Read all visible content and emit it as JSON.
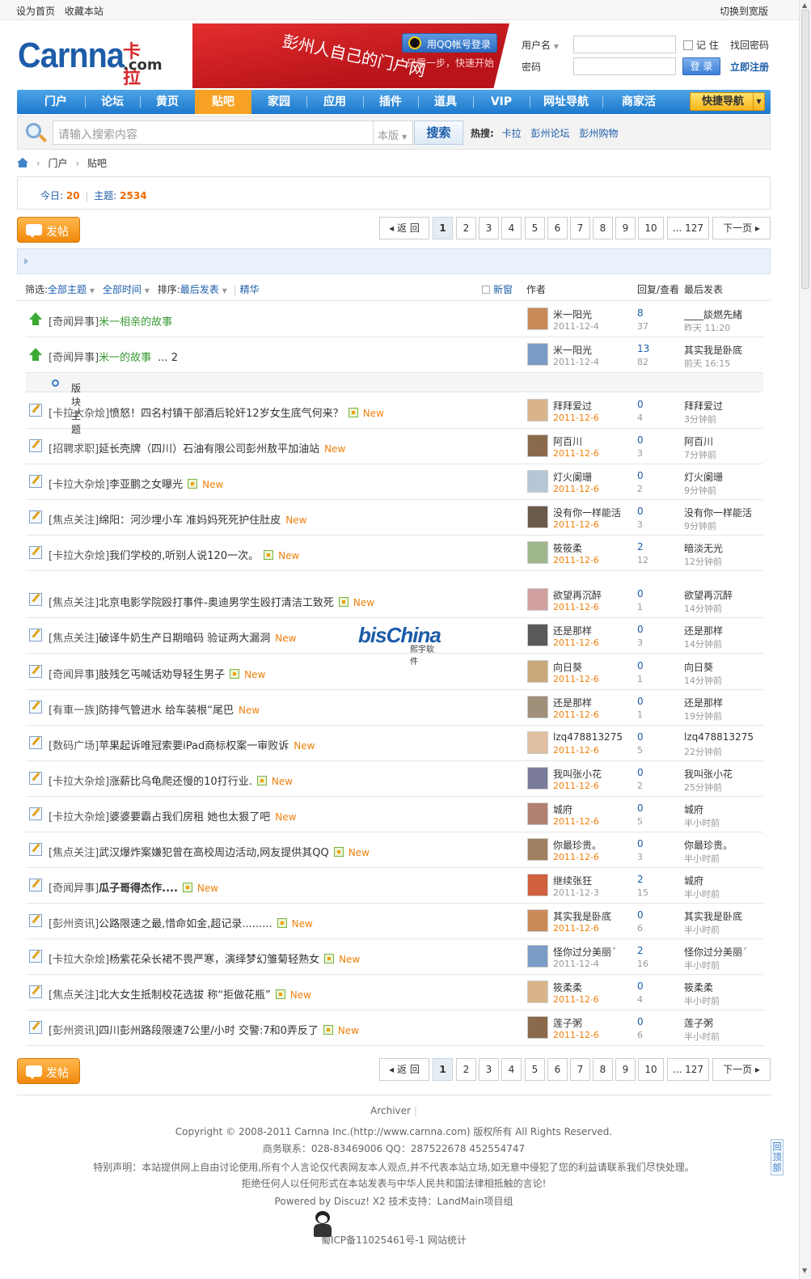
{
  "topbar": {
    "set_home": "设为首页",
    "favorite": "收藏本站",
    "switch_width": "切换到宽版"
  },
  "logo": {
    "text": "Carnna",
    "cn": "卡拉",
    "tld": ".com"
  },
  "banner": {
    "slogan": "彭州人自己的门户网",
    "qq_login": "用QQ帐号登录",
    "qq_sub": "只需一步，快速开始"
  },
  "login": {
    "username_label": "用户名",
    "password_label": "密码",
    "remember": "记 住",
    "forgot": "找回密码",
    "login_btn": "登 录",
    "register": "立即注册"
  },
  "nav": {
    "items": [
      "门户",
      "论坛",
      "黄页",
      "贴吧",
      "家园",
      "应用",
      "插件",
      "道具",
      "VIP",
      "网址导航",
      "商家活"
    ],
    "active": "贴吧",
    "quick": "快捷导航"
  },
  "search": {
    "placeholder": "请输入搜索内容",
    "scope": "本版",
    "button": "搜索",
    "hot_label": "热搜:",
    "hot": [
      "卡拉",
      "彭州论坛",
      "彭州购物"
    ]
  },
  "breadcrumb": {
    "items": [
      "门户",
      "贴吧"
    ]
  },
  "stats": {
    "today_label": "今日:",
    "today": "20",
    "topics_label": "主题:",
    "topics": "2534"
  },
  "pager": {
    "post_btn": "发帖",
    "back": "返 回",
    "pages": [
      "1",
      "2",
      "3",
      "4",
      "5",
      "6",
      "7",
      "8",
      "9",
      "10"
    ],
    "last": "... 127",
    "next": "下一页"
  },
  "filters": {
    "filter_label": "筛选:",
    "all_topics": "全部主题",
    "all_time": "全部时间",
    "sort_label": "排序:",
    "last_post": "最后发表",
    "digest": "精华",
    "new_window": "新窗",
    "col_author": "作者",
    "col_replies": "回复/查看",
    "col_last": "最后发表"
  },
  "section_label": "版块主题",
  "sticky": [
    {
      "cat": "[奇闻异事]",
      "title": "米一相亲的故事",
      "author": "米一阳光",
      "date": "2011-12-4",
      "replies": "8",
      "views": "37",
      "last_author": "____談燃先緒",
      "last_time": "昨天 11:20",
      "pages": ""
    },
    {
      "cat": "[奇闻异事]",
      "title": "米一的故事",
      "author": "米一阳光",
      "date": "2011-12-4",
      "replies": "13",
      "views": "82",
      "last_author": "其实我是卧底",
      "last_time": "前天 16:15",
      "pages": "... 2"
    }
  ],
  "threads": [
    {
      "cat": "[卡拉大杂烩]",
      "title": "愤怒！四名村镇干部酒后轮奸12岁女生底气何来？",
      "author": "拜拜爱过",
      "date": "2011-12-6",
      "replies": "0",
      "views": "4",
      "last_author": "拜拜爱过",
      "last_time": "3分钟前",
      "img": true,
      "newdate": true
    },
    {
      "cat": "[招聘求职]",
      "title": "延长壳牌（四川）石油有限公司彭州敖平加油站",
      "author": "阿百川",
      "date": "2011-12-6",
      "replies": "0",
      "views": "3",
      "last_author": "阿百川",
      "last_time": "7分钟前",
      "img": false,
      "newdate": true
    },
    {
      "cat": "[卡拉大杂烩]",
      "title": "李亚鹏之女曝光",
      "author": "灯火阑珊",
      "date": "2011-12-6",
      "replies": "0",
      "views": "2",
      "last_author": "灯火阑珊",
      "last_time": "9分钟前",
      "img": true,
      "newdate": true
    },
    {
      "cat": "[焦点关注]",
      "title": "绵阳：河沙埋小车  准妈妈死死护住肚皮",
      "author": "没有你一样能活",
      "date": "2011-12-6",
      "replies": "0",
      "views": "3",
      "last_author": "没有你一样能活",
      "last_time": "9分钟前",
      "img": false,
      "newdate": true
    },
    {
      "cat": "[卡拉大杂烩]",
      "title": "我们学校的,听别人说120一次。",
      "author": "筱筱柔",
      "date": "2011-12-6",
      "replies": "2",
      "views": "12",
      "last_author": "暗淡无光",
      "last_time": "12分钟前",
      "img": true,
      "newdate": true
    },
    {
      "cat": "[焦点关注]",
      "title": "北京电影学院殴打事件-奥迪男学生殴打清洁工致死",
      "author": "欲望再沉醉",
      "date": "2011-12-6",
      "replies": "0",
      "views": "1",
      "last_author": "欲望再沉醉",
      "last_time": "14分钟前",
      "img": true,
      "newdate": true
    },
    {
      "cat": "[焦点关注]",
      "title": "破译牛奶生产日期暗码  验证两大漏洞",
      "author": "还是那样",
      "date": "2011-12-6",
      "replies": "0",
      "views": "3",
      "last_author": "还是那样",
      "last_time": "14分钟前",
      "img": false,
      "newdate": true
    },
    {
      "cat": "[奇闻异事]",
      "title": "肢残乞丐喊话劝导轻生男子",
      "author": "向日葵",
      "date": "2011-12-6",
      "replies": "0",
      "views": "1",
      "last_author": "向日葵",
      "last_time": "14分钟前",
      "img": true,
      "newdate": true
    },
    {
      "cat": "[有車一族]",
      "title": "防排气管进水 给车装根“尾巴",
      "author": "还是那样",
      "date": "2011-12-6",
      "replies": "0",
      "views": "1",
      "last_author": "还是那样",
      "last_time": "19分钟前",
      "img": false,
      "newdate": true
    },
    {
      "cat": "[数码广场]",
      "title": "苹果起诉唯冠索要iPad商标权案一审败诉",
      "author": "lzq478813275",
      "date": "2011-12-6",
      "replies": "0",
      "views": "5",
      "last_author": "lzq478813275",
      "last_time": "22分钟前",
      "img": false,
      "newdate": true
    },
    {
      "cat": "[卡拉大杂烩]",
      "title": "涨薪比乌龟爬还慢的10打行业.",
      "author": "我叫张小花",
      "date": "2011-12-6",
      "replies": "0",
      "views": "2",
      "last_author": "我叫张小花",
      "last_time": "25分钟前",
      "img": true,
      "newdate": true
    },
    {
      "cat": "[卡拉大杂烩]",
      "title": "婆婆要霸占我们房租  她也太狠了吧",
      "author": "城府",
      "date": "2011-12-6",
      "replies": "0",
      "views": "5",
      "last_author": "城府",
      "last_time": "半小时前",
      "img": false,
      "newdate": true
    },
    {
      "cat": "[焦点关注]",
      "title": "武汉爆炸案嫌犯曾在高校周边活动,网友提供其QQ",
      "author": "你最珍贵。",
      "date": "2011-12-6",
      "replies": "0",
      "views": "3",
      "last_author": "你最珍贵。",
      "last_time": "半小时前",
      "img": true,
      "newdate": true
    },
    {
      "cat": "[奇闻异事]",
      "title": "瓜子哥得杰作....",
      "author": "继续张狂",
      "date": "2011-12-3",
      "replies": "2",
      "views": "15",
      "last_author": "城府",
      "last_time": "半小时前",
      "img": true,
      "newdate": false,
      "bold": true
    },
    {
      "cat": "[彭州资讯]",
      "title": "公路限速之最,惜命如金,超记录.........",
      "author": "其实我是卧底",
      "date": "2011-12-6",
      "replies": "0",
      "views": "6",
      "last_author": "其实我是卧底",
      "last_time": "半小时前",
      "img": true,
      "newdate": true
    },
    {
      "cat": "[卡拉大杂烩]",
      "title": "杨紫花朵长裙不畏严寒，演绎梦幻雏菊轻熟女",
      "author": "怪你过分美丽ˊ",
      "date": "2011-12-4",
      "replies": "2",
      "views": "16",
      "last_author": "怪你过分美丽ˊ",
      "last_time": "半小时前",
      "img": true,
      "newdate": false
    },
    {
      "cat": "[焦点关注]",
      "title": "北大女生抵制校花选拔 称“拒做花瓶”",
      "author": "筱柔柔",
      "date": "2011-12-6",
      "replies": "0",
      "views": "4",
      "last_author": "筱柔柔",
      "last_time": "半小时前",
      "img": true,
      "newdate": true
    },
    {
      "cat": "[彭州资讯]",
      "title": "四川彭州路段限速7公里/小时 交警:7和0弄反了",
      "author": "莲子粥",
      "date": "2011-12-6",
      "replies": "0",
      "views": "6",
      "last_author": "莲子粥",
      "last_time": "半小时前",
      "img": true,
      "newdate": true
    }
  ],
  "new_label": "New",
  "watermark": {
    "brand": "bisChina",
    "sub": "熙宇软件"
  },
  "footer": {
    "archiver": "Archiver",
    "copyright": "Copyright © 2008-2011 Carnna Inc.(http://www.carnna.com) 版权所有  All Rights Reserved.",
    "contact": "商务联系：028-83469006 QQ：287522678 452554747",
    "notice": "特别声明：本站提供网上自由讨论使用,所有个人言论仅代表网友本人观点,并不代表本站立场,如无意中侵犯了您的利益请联系我们尽快处理。",
    "law": "拒绝任何人以任何形式在本站发表与中华人民共和国法律相抵触的言论!",
    "powered": "Powered by Discuz! X2 技术支持：LandMain项目组",
    "icp": "蜀ICP备11025461号-1 网站统计",
    "to_top": "回顶部"
  },
  "colors": {
    "nav_blue": "#1c78cc",
    "nav_active": "#f7a224",
    "link_blue": "#1c5ca8",
    "new_orange": "#f07f0a",
    "sticky_green": "#3a9a34"
  }
}
